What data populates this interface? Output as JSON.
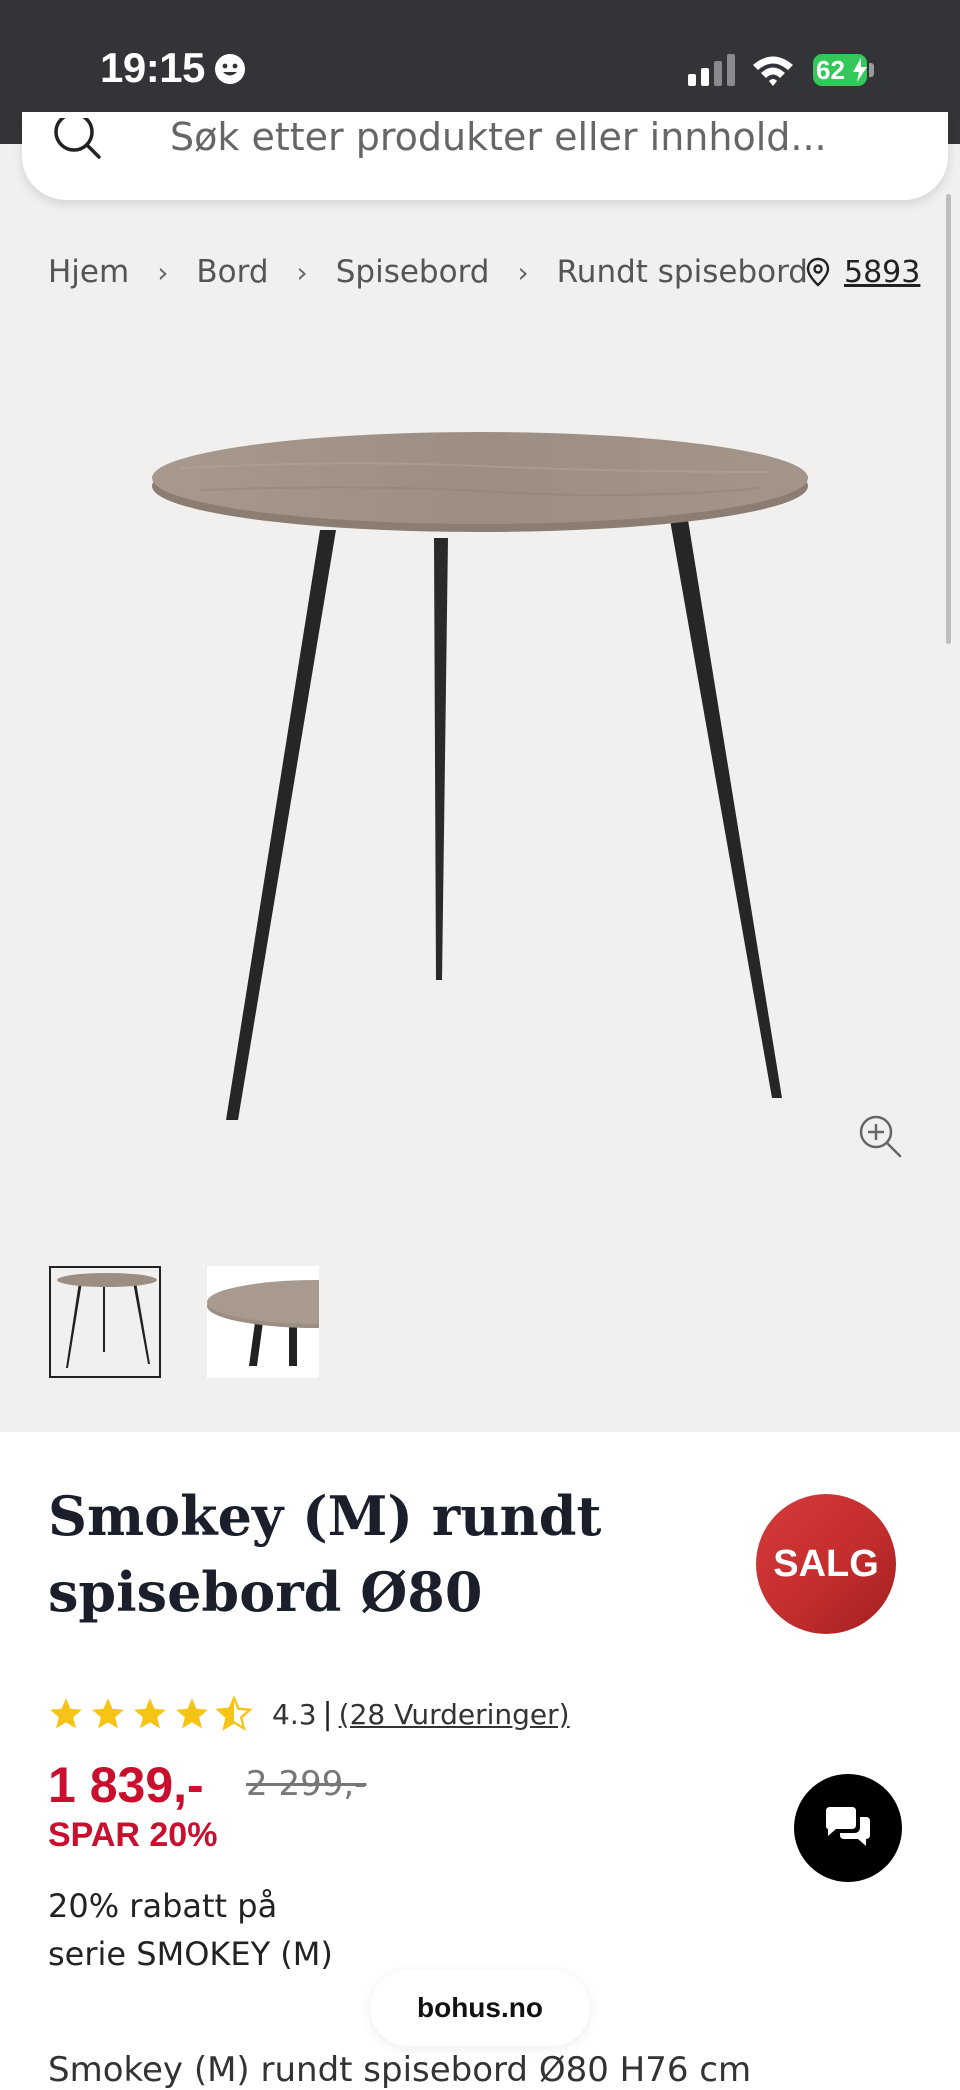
{
  "status_bar": {
    "time": "19:15",
    "battery": "62"
  },
  "search": {
    "placeholder": "Søk etter produkter eller innhold..."
  },
  "breadcrumb": [
    "Hjem",
    "Bord",
    "Spisebord",
    "Rundt spisebord"
  ],
  "location": {
    "postcode": "5893"
  },
  "product": {
    "title_line1": "Smokey (M) rundt",
    "title_line2": "spisebord Ø80",
    "sale_badge": "SALG",
    "rating_value": "4.3",
    "rating_separator": "|",
    "rating_link": "(28 Vurderinger)",
    "stars": 4.3,
    "price": "1 839,-",
    "old_price": "2 299,-",
    "save": "SPAR 20%",
    "discount_line1": "20% rabatt på",
    "discount_line2": "serie SMOKEY (M)",
    "description": "Smokey (M) rundt spisebord Ø80 H76 cm"
  },
  "browser": {
    "url": "bohus.no"
  },
  "icons": [
    "search-icon",
    "location-pin-icon",
    "zoom-in-icon",
    "chat-icon",
    "star-icon"
  ],
  "colors": {
    "price_red": "#c8102e",
    "sale_red": "#c42d2d",
    "star_yellow": "#f6c416",
    "status_bar": "#333438"
  }
}
